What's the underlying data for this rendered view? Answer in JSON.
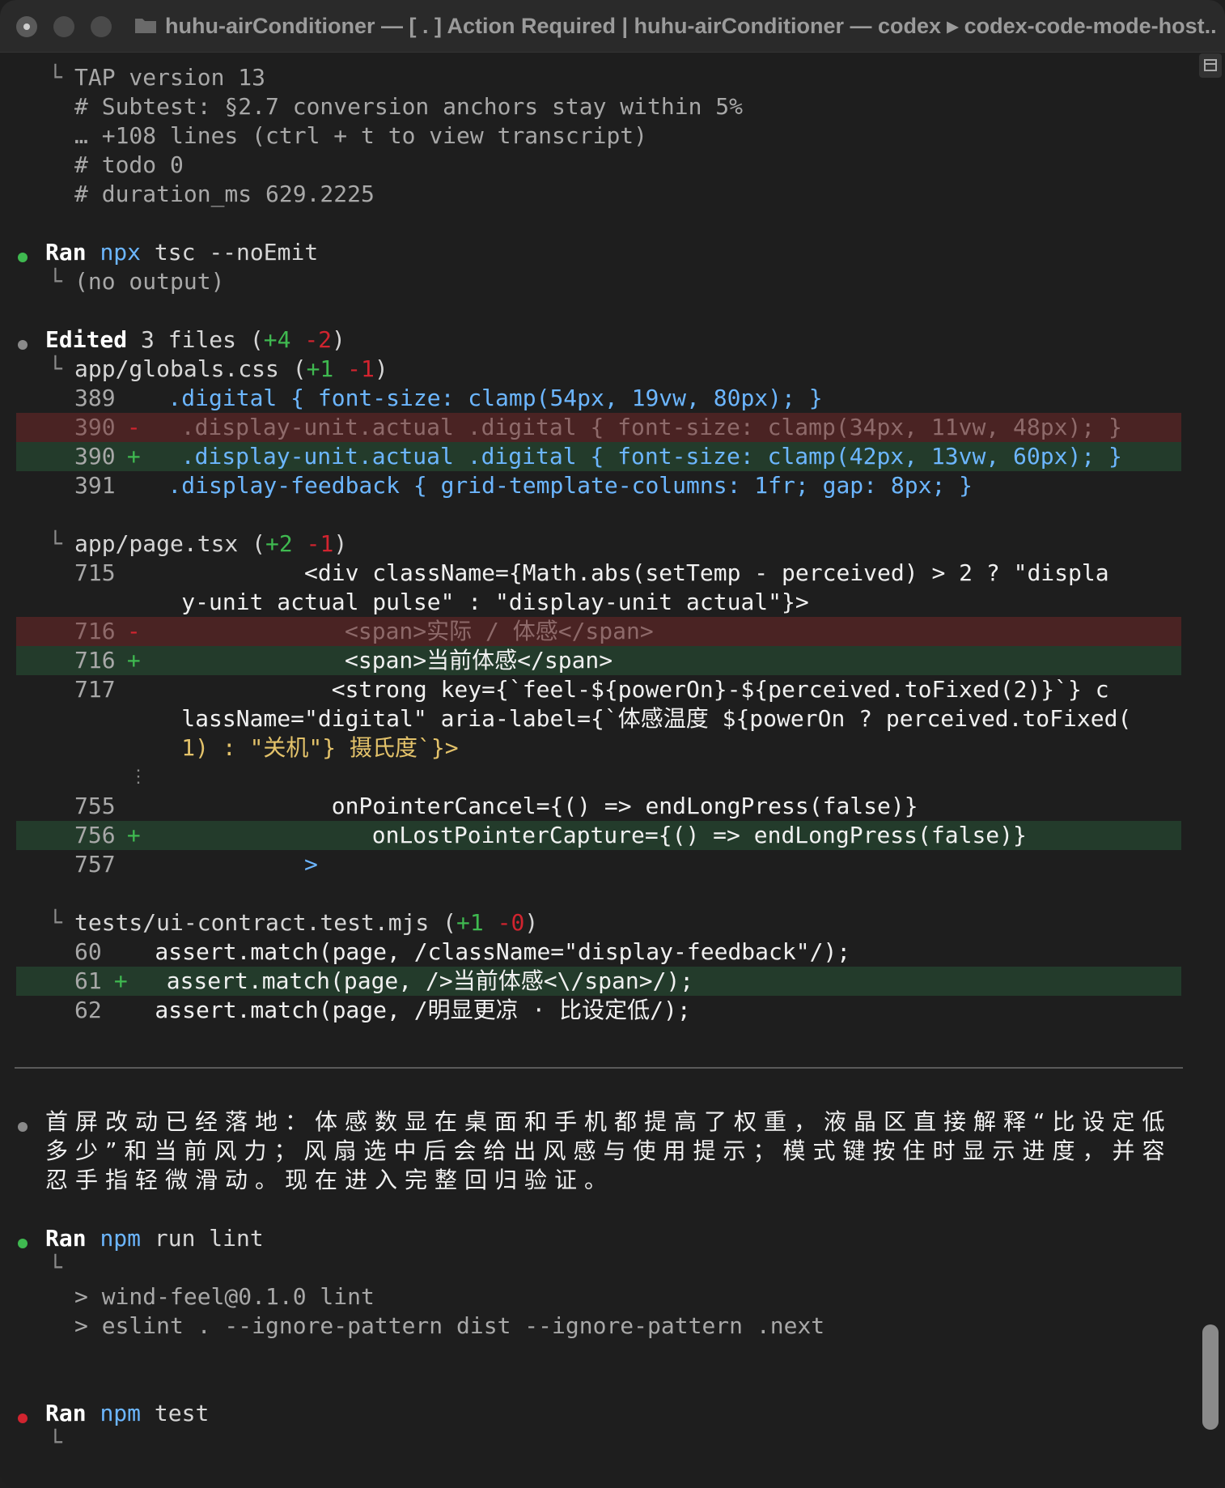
{
  "window": {
    "title": "huhu-airConditioner — [ . ] Action Required | huhu-airConditioner — codex ▸ codex-code-mode-host..."
  },
  "colors": {
    "background": "#1e1e1e",
    "green_bullet": "#3fb950",
    "red_bullet": "#d1242f",
    "grey_bullet": "#8a8a8a",
    "add_bg": "#233b2b",
    "del_bg": "#4a2323",
    "accent_blue": "#6cb6ff"
  },
  "tap_output": {
    "line1": "TAP version 13",
    "line2": "# Subtest: §2.7 conversion anchors stay within 5%",
    "line3": "… +108 lines (ctrl + t to view transcript)",
    "line4": "# todo 0",
    "line5": "# duration_ms 629.2225"
  },
  "ran_tsc": {
    "ran": "Ran",
    "cmd1": "npx",
    "cmd_rest_a": " tsc ",
    "cmd_rest_b": "--noEmit",
    "output": "(no output)"
  },
  "edited": {
    "label": "Edited",
    "summary": " 3 files (",
    "plus": "+4",
    "minus": "-2",
    "close": ")"
  },
  "file1": {
    "name": "app/globals.css (",
    "plus": "+1",
    "minus": "-1",
    "close": ")",
    "rows": {
      "r389_num": "389",
      "r389_code": "    .digital { font-size: clamp(54px, 19vw, 80px); }",
      "r390d_num": "390",
      "r390d_mark": " -",
      "r390d_code": "  .display-unit.actual .digital { font-size: clamp(34px, 11vw, 48px); }",
      "r390a_num": "390",
      "r390a_mark": " +",
      "r390a_code": "  .display-unit.actual .digital { font-size: clamp(42px, 13vw, 60px); }",
      "r391_num": "391",
      "r391_code": "    .display-feedback { grid-template-columns: 1fr; gap: 8px; }"
    }
  },
  "file2": {
    "name": "app/page.tsx (",
    "plus": "+2",
    "minus": "-1",
    "close": ")",
    "rows": {
      "r715_num": "715",
      "r715_code": "              <div className={Math.abs(setTemp - perceived) > 2 ? \"displa",
      "r715_cont": "     y-unit actual pulse\" : \"display-unit actual\"}>",
      "r716d_num": "716",
      "r716d_mark": " -",
      "r716d_code": "              <span>实际 / 体感</span>",
      "r716a_num": "716",
      "r716a_mark": " +",
      "r716a_code": "              <span>当前体感</span>",
      "r717_num": "717",
      "r717_code": "                <strong key={`feel-${powerOn}-${perceived.toFixed(2)}`} c",
      "r717_cont1": "     lassName=\"digital\" aria-label={`体感温度 ${powerOn ? perceived.toFixed(",
      "r717_cont2": "     1) : \"关机\"} 摄氏度`}>",
      "ellipsis": "⋮",
      "r755_num": "755",
      "r755_code": "                onPointerCancel={() => endLongPress(false)}",
      "r756_num": "756",
      "r756_mark": " +",
      "r756_code": "                onLostPointerCapture={() => endLongPress(false)}",
      "r757_num": "757",
      "r757_code": "              >"
    }
  },
  "file3": {
    "name": "tests/ui-contract.test.mjs (",
    "plus": "+1",
    "minus": "-0",
    "close": ")",
    "rows": {
      "r60_num": "60",
      "r60_code": "    assert.match(page, /className=\"display-feedback\"/);",
      "r61_num": "61",
      "r61_mark": " +",
      "r61_code": "  assert.match(page, />当前体感<\\/span>/);",
      "r62_num": "62",
      "r62_code": "    assert.match(page, /明显更凉 · 比设定低/);"
    }
  },
  "message": {
    "text": "首屏改动已经落地：体感数显在桌面和手机都提高了权重，液晶区直接解释“比设定低多少”和当前风力；风扇选中后会给出风感与使用提示；模式键按住时显示进度，并容忍手指轻微滑动。现在进入完整回归验证。"
  },
  "ran_lint": {
    "ran": "Ran",
    "cmd1": "npm",
    "cmd_rest": " run lint",
    "out1": "> wind-feel@0.1.0 lint",
    "out2": "> eslint . --ignore-pattern dist --ignore-pattern .next"
  },
  "ran_test": {
    "ran": "Ran",
    "cmd1": "npm",
    "cmd_rest": " test"
  },
  "glyphs": {
    "tree": "└"
  }
}
